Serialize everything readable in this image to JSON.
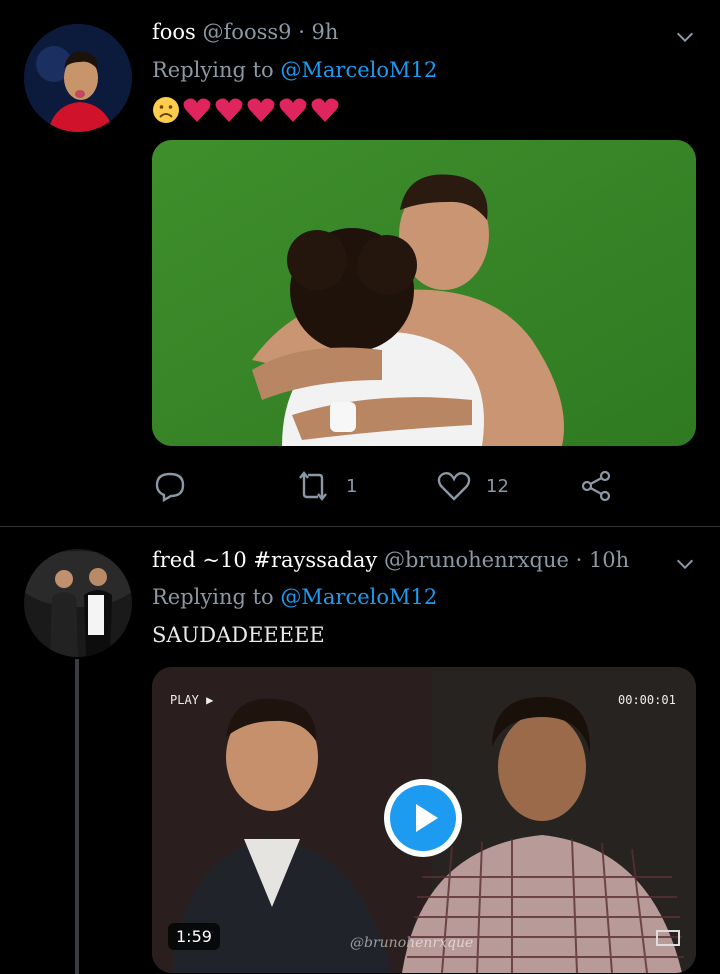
{
  "tweet1": {
    "name": "foos",
    "handle": "@fooss9",
    "time": "· 9h",
    "replying_label": "Replying to",
    "replying_to": "@MarceloM12",
    "emoji": [
      "☹",
      "❤",
      "❤",
      "❤",
      "❤",
      "❤"
    ],
    "retweets": "1",
    "likes": "12"
  },
  "tweet2": {
    "name": "fred ~10 #rayssaday",
    "handle": "@brunohenrxque",
    "time": "· 10h",
    "replying_label": "Replying to",
    "replying_to": "@MarceloM12",
    "text": "SAUDADEEEEE",
    "video": {
      "play_label": "PLAY ▶",
      "timecode": "00:00:01",
      "duration": "1:59",
      "watermark": "@brunohenrxque"
    }
  },
  "colors": {
    "accent": "#1d9bf0",
    "muted": "#8b98a5",
    "heart": "#e0245e",
    "emoji_face": "#ffcc4d"
  }
}
